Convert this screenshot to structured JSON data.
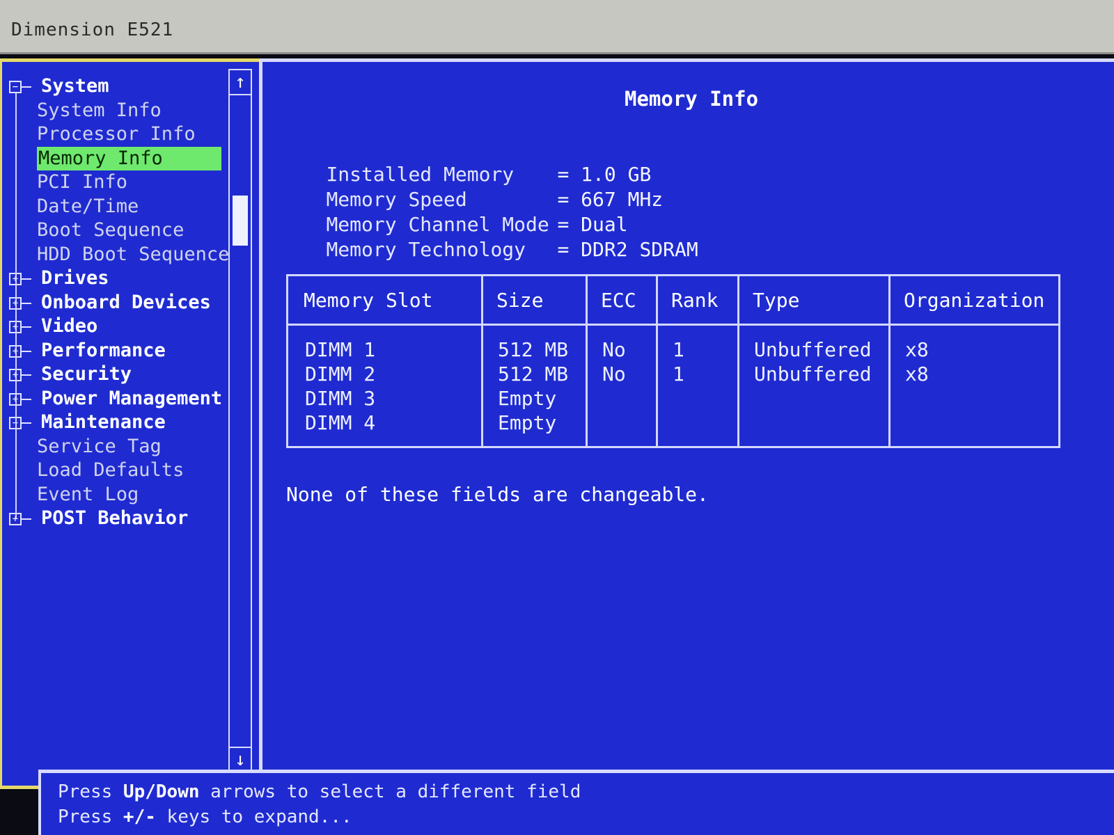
{
  "window": {
    "title": "Dimension E521"
  },
  "tree": [
    {
      "label": "System",
      "kind": "category",
      "expand": "minus"
    },
    {
      "label": "System Info",
      "kind": "item"
    },
    {
      "label": "Processor Info",
      "kind": "item"
    },
    {
      "label": "Memory Info",
      "kind": "item",
      "selected": true
    },
    {
      "label": "PCI Info",
      "kind": "item"
    },
    {
      "label": "Date/Time",
      "kind": "item"
    },
    {
      "label": "Boot Sequence",
      "kind": "item"
    },
    {
      "label": "HDD Boot Sequence",
      "kind": "item"
    },
    {
      "label": "Drives",
      "kind": "category",
      "expand": "plus"
    },
    {
      "label": "Onboard Devices",
      "kind": "category",
      "expand": "plus"
    },
    {
      "label": "Video",
      "kind": "category",
      "expand": "plus"
    },
    {
      "label": "Performance",
      "kind": "category",
      "expand": "plus"
    },
    {
      "label": "Security",
      "kind": "category",
      "expand": "plus"
    },
    {
      "label": "Power Management",
      "kind": "category",
      "expand": "plus"
    },
    {
      "label": "Maintenance",
      "kind": "category",
      "expand": "minus"
    },
    {
      "label": "Service Tag",
      "kind": "item"
    },
    {
      "label": "Load Defaults",
      "kind": "item"
    },
    {
      "label": "Event Log",
      "kind": "item"
    },
    {
      "label": "POST Behavior",
      "kind": "category",
      "expand": "plus"
    }
  ],
  "scrollbar": {
    "up_glyph": "↑",
    "down_glyph": "↓"
  },
  "panel": {
    "title": "Memory Info",
    "info": [
      {
        "label": "Installed Memory",
        "value": "= 1.0 GB"
      },
      {
        "label": "Memory Speed",
        "value": "= 667 MHz"
      },
      {
        "label": "Memory Channel Mode",
        "value": "= Dual"
      },
      {
        "label": "Memory Technology",
        "value": "= DDR2 SDRAM"
      }
    ],
    "table": {
      "headers": [
        "Memory Slot",
        "Size",
        "ECC",
        "Rank",
        "Type",
        "Organization"
      ],
      "rows": [
        [
          "DIMM 1",
          "512 MB",
          "No",
          "1",
          "Unbuffered",
          "x8"
        ],
        [
          "DIMM 2",
          "512 MB",
          "No",
          "1",
          "Unbuffered",
          "x8"
        ],
        [
          "DIMM 3",
          "Empty",
          "",
          "",
          "",
          ""
        ],
        [
          "DIMM 4",
          "Empty",
          "",
          "",
          "",
          ""
        ]
      ]
    },
    "note": "None of these fields are changeable."
  },
  "help": {
    "line1": {
      "pre": "Press ",
      "key": "Up/Down",
      "post": " arrows to select a different field"
    },
    "line2": {
      "pre": "Press ",
      "key": "+/-",
      "post": " keys to expand..."
    }
  },
  "colors": {
    "background": "#1f2bd0",
    "highlight": "#6fe96d",
    "frame": "#e3d96a"
  }
}
